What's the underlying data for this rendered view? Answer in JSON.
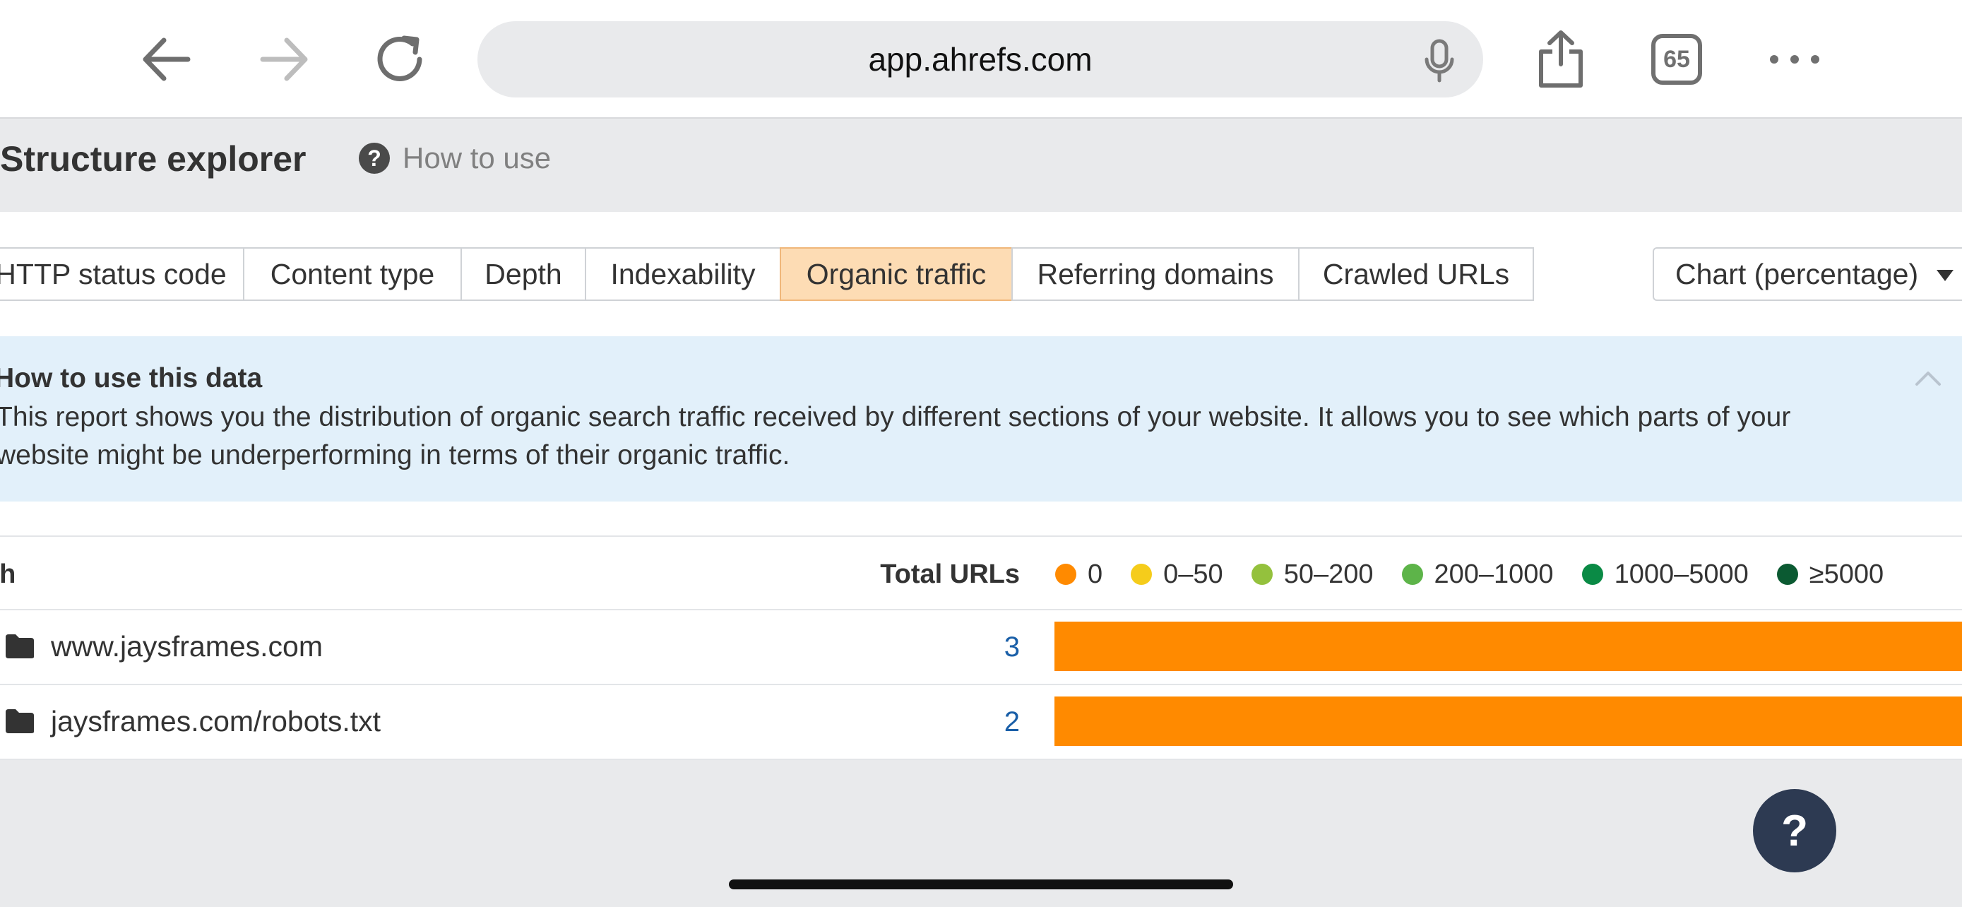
{
  "browser": {
    "url": "app.ahrefs.com",
    "tab_count": "65",
    "icons": [
      "back-arrow-icon",
      "forward-arrow-icon",
      "reload-icon",
      "microphone-icon",
      "share-icon",
      "tabs-icon",
      "more-icon"
    ]
  },
  "header": {
    "title": "Structure explorer",
    "how_to_use": "How to use",
    "help_glyph": "?"
  },
  "tabs": [
    {
      "label": "HTTP status code",
      "active": false
    },
    {
      "label": "Content type",
      "active": false
    },
    {
      "label": "Depth",
      "active": false
    },
    {
      "label": "Indexability",
      "active": false
    },
    {
      "label": "Organic traffic",
      "active": true
    },
    {
      "label": "Referring domains",
      "active": false
    },
    {
      "label": "Crawled URLs",
      "active": false
    }
  ],
  "view_select": {
    "value": "Chart (percentage)"
  },
  "info": {
    "title": "How to use this data",
    "body": "This report shows you the distribution of organic search traffic received by different sections of your website. It allows you to see which parts of your website might be underperforming in terms of their organic traffic."
  },
  "table": {
    "columns": {
      "path": "Path",
      "total": "Total URLs"
    },
    "legend": [
      {
        "label": "0",
        "color": "#ff8a00"
      },
      {
        "label": "0–50",
        "color": "#f5cc1b"
      },
      {
        "label": "50–200",
        "color": "#94c13d"
      },
      {
        "label": "200–1000",
        "color": "#5db449"
      },
      {
        "label": "1000–5000",
        "color": "#0a8a45"
      },
      {
        "label": "≥5000",
        "color": "#0b5a32"
      }
    ],
    "rows": [
      {
        "path": "www.jaysframes.com",
        "total": "3",
        "bar": {
          "segment": "0",
          "percent": 100,
          "color": "#ff8a00"
        }
      },
      {
        "path": "jaysframes.com/robots.txt",
        "total": "2",
        "bar": {
          "segment": "0",
          "percent": 100,
          "color": "#ff8a00"
        }
      }
    ]
  },
  "fab": {
    "label": "?"
  }
}
